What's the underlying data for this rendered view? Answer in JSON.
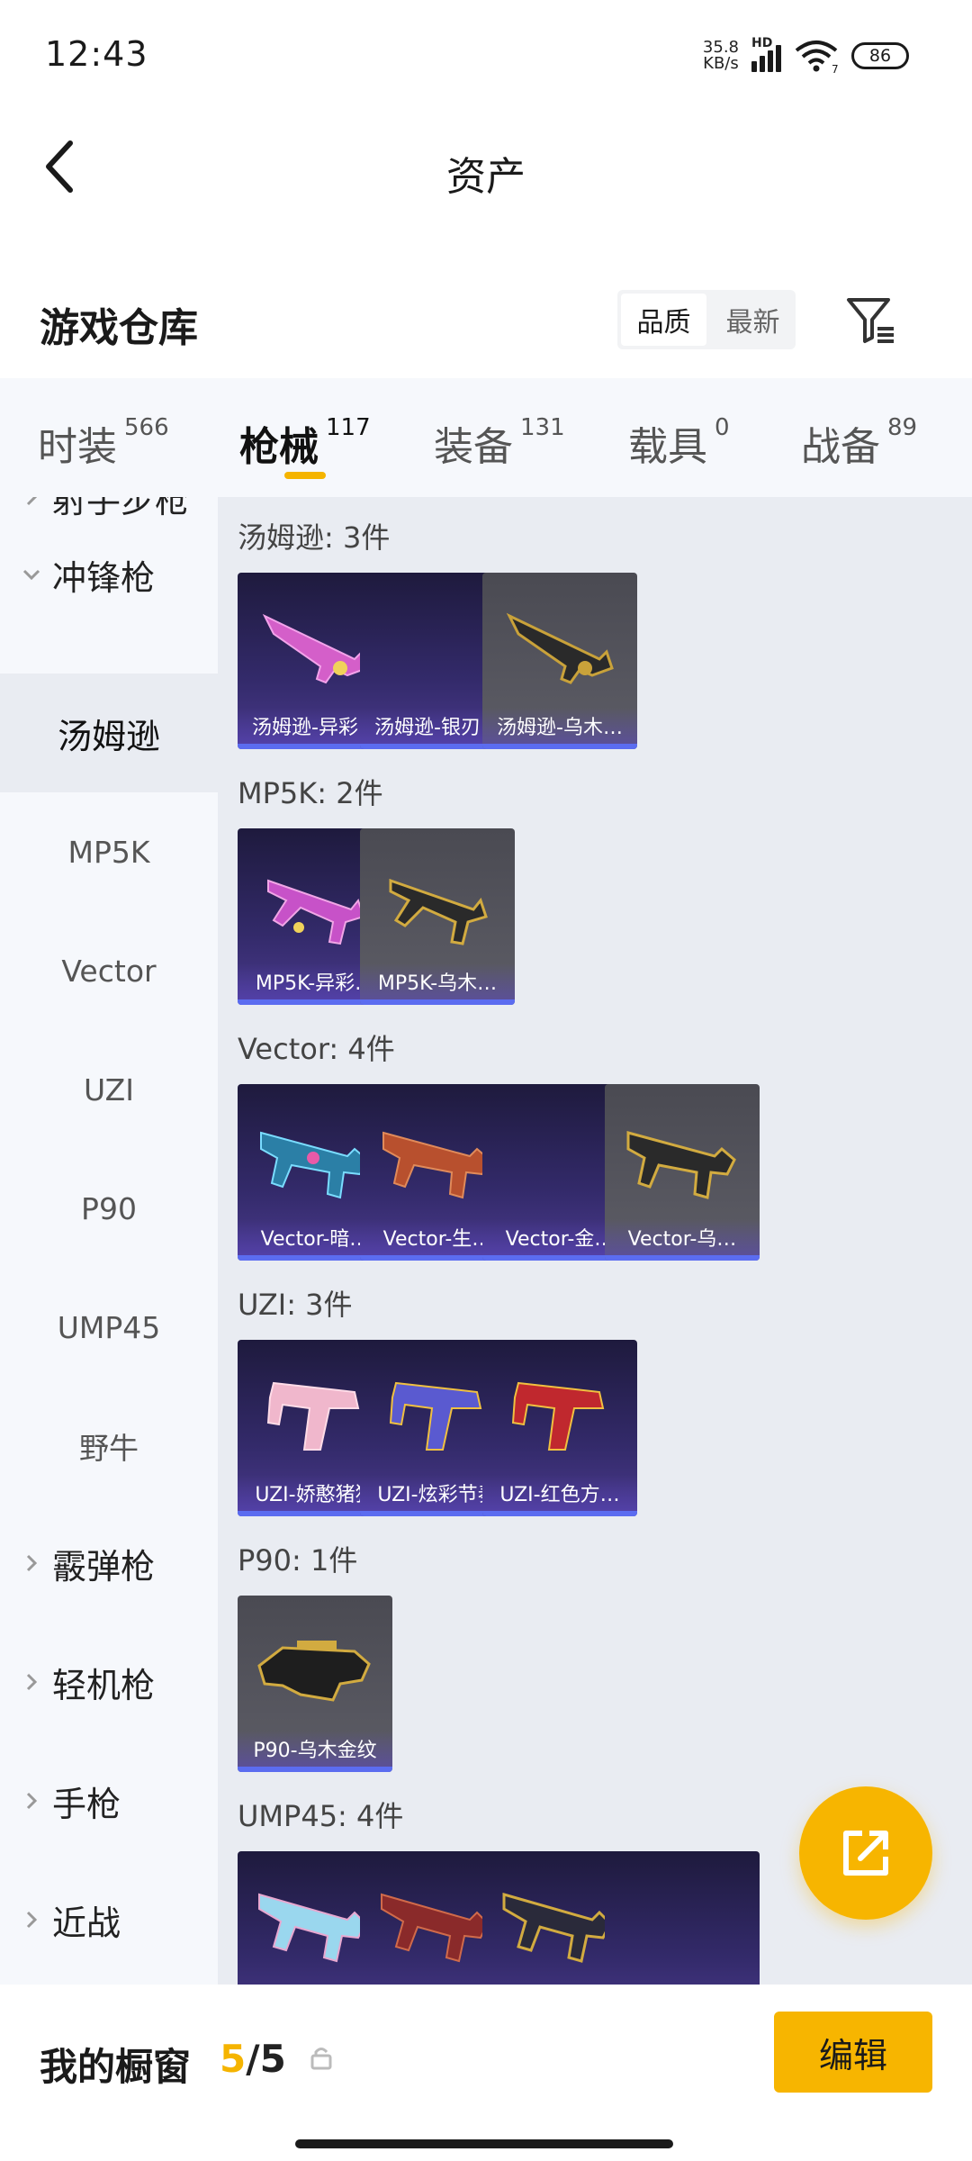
{
  "status_bar": {
    "time": "12:43",
    "net_speed_value": "35.8",
    "net_speed_unit": "KB/s",
    "hd": "HD",
    "wifi_badge": "7",
    "battery": "86"
  },
  "header": {
    "title": "资产"
  },
  "warehouse": {
    "title": "游戏仓库",
    "sort_options": [
      "品质",
      "最新"
    ],
    "active_sort": "品质"
  },
  "tabs": [
    {
      "label": "时装",
      "count": "566"
    },
    {
      "label": "枪械",
      "count": "117"
    },
    {
      "label": "装备",
      "count": "131"
    },
    {
      "label": "载具",
      "count": "0"
    },
    {
      "label": "战备",
      "count": "89"
    }
  ],
  "active_tab": "枪械",
  "sidebar": {
    "partial_top": "射手步枪",
    "group_smg": "冲锋枪",
    "subs": [
      "汤姆逊",
      "MP5K",
      "Vector",
      "UZI",
      "P90",
      "UMP45",
      "野牛"
    ],
    "active_sub": "汤姆逊",
    "groups_after": [
      "霰弹枪",
      "轻机枪",
      "手枪",
      "近战"
    ]
  },
  "groups": [
    {
      "title": "汤姆逊: 3件",
      "items": [
        "汤姆逊-异彩…",
        "汤姆逊-银刃…",
        "汤姆逊-乌木…"
      ]
    },
    {
      "title": "MP5K: 2件",
      "items": [
        "MP5K-异彩…",
        "MP5K-乌木…"
      ]
    },
    {
      "title": "Vector: 4件",
      "items": [
        "Vector-暗…",
        "Vector-生…",
        "Vector-金…",
        "Vector-乌…"
      ]
    },
    {
      "title": "UZI: 3件",
      "items": [
        "UZI-娇憨猪猪",
        "UZI-炫彩节奏",
        "UZI-红色方…"
      ]
    },
    {
      "title": "P90: 1件",
      "items": [
        "P90-乌木金纹"
      ]
    },
    {
      "title": "UMP45: 4件",
      "items": [
        "",
        "",
        "",
        ""
      ]
    }
  ],
  "bottom_bar": {
    "label": "我的橱窗",
    "current": "5",
    "total": "/5",
    "edit": "编辑"
  },
  "colors": {
    "accent": "#f7b500",
    "card_purple": "#332a6a",
    "card_gray": "#55555e",
    "card_underline": "#5b6cf0"
  }
}
